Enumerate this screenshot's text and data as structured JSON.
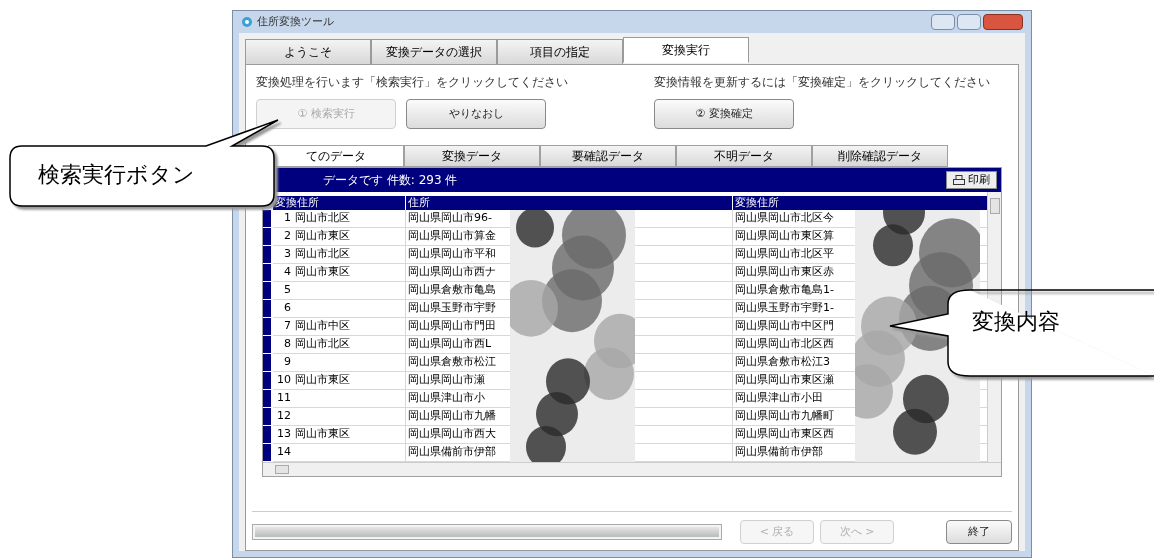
{
  "window": {
    "title": "住所変換ツール"
  },
  "tabs": [
    {
      "label": "ようこそ",
      "selected": false
    },
    {
      "label": "変換データの選択",
      "selected": false
    },
    {
      "label": "項目の指定",
      "selected": false
    },
    {
      "label": "変換実行",
      "selected": true
    }
  ],
  "steps": [
    {
      "instruction": "変換処理を行います「検索実行」をクリックしてください",
      "buttons": [
        {
          "label": "① 検索実行",
          "disabled": true
        },
        {
          "label": "やりなおし",
          "disabled": false
        }
      ]
    },
    {
      "instruction": "変換情報を更新するには「変換確定」をクリックしてください",
      "buttons": [
        {
          "label": "② 変換確定",
          "disabled": false
        }
      ]
    }
  ],
  "data_tabs": [
    {
      "label": "てのデータ",
      "selected": true
    },
    {
      "label": "変換データ",
      "selected": false
    },
    {
      "label": "要確認データ",
      "selected": false
    },
    {
      "label": "不明データ",
      "selected": false
    },
    {
      "label": "削除確認データ",
      "selected": false
    }
  ],
  "grid": {
    "caption": "データです 件数: 293 件",
    "print_button": "印刷",
    "columns": [
      "変換住所",
      "住所",
      "変換住所"
    ],
    "rows": [
      {
        "no": "1",
        "ward": "岡山市北区",
        "address": "岡山県岡山市96-",
        "converted": "岡山県岡山市北区今"
      },
      {
        "no": "2",
        "ward": "岡山市東区",
        "address": "岡山県岡山市算金",
        "converted": "岡山県岡山市東区算"
      },
      {
        "no": "3",
        "ward": "岡山市北区",
        "address": "岡山県岡山市平和",
        "converted": "岡山県岡山市北区平"
      },
      {
        "no": "4",
        "ward": "岡山市東区",
        "address": "岡山県岡山市西ナ",
        "converted": "岡山県岡山市東区赤"
      },
      {
        "no": "5",
        "ward": "",
        "address": "岡山県倉敷市亀島",
        "converted": "岡山県倉敷市亀島1-"
      },
      {
        "no": "6",
        "ward": "",
        "address": "岡山県玉野市宇野",
        "converted": "岡山県玉野市宇野1-"
      },
      {
        "no": "7",
        "ward": "岡山市中区",
        "address": "岡山県岡山市門田",
        "converted": "岡山県岡山市中区門"
      },
      {
        "no": "8",
        "ward": "岡山市北区",
        "address": "岡山県岡山市西L",
        "converted": "岡山県岡山市北区西"
      },
      {
        "no": "9",
        "ward": "",
        "address": "岡山県倉敷市松江",
        "converted": "岡山県倉敷市松江3"
      },
      {
        "no": "10",
        "ward": "岡山市東区",
        "address": "岡山県岡山市瀬",
        "converted": "岡山県岡山市東区瀬"
      },
      {
        "no": "11",
        "ward": "",
        "address": "岡山県津山市小",
        "converted": "岡山県津山市小田"
      },
      {
        "no": "12",
        "ward": "",
        "address": "岡山県岡山市九幡",
        "converted": "岡山県岡山市九幡町"
      },
      {
        "no": "13",
        "ward": "岡山市東区",
        "address": "岡山県岡山市西大",
        "converted": "岡山県岡山市東区西"
      },
      {
        "no": "14",
        "ward": "",
        "address": "岡山県備前市伊部",
        "converted": "岡山県備前市伊部"
      }
    ]
  },
  "progress": {
    "level": 1
  },
  "footer_buttons": [
    {
      "label": "< 戻る",
      "disabled": true
    },
    {
      "label": "次へ >",
      "disabled": true
    },
    {
      "label": "終了",
      "disabled": false
    }
  ],
  "callouts": [
    {
      "text": "検索実行ボタン"
    },
    {
      "text": "変換内容"
    }
  ]
}
